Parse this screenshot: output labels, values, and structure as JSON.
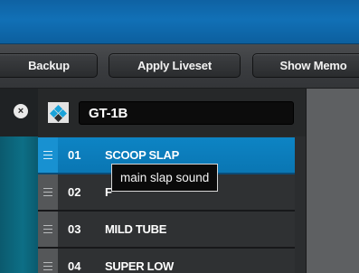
{
  "toolbar": {
    "backup_label": "Backup",
    "apply_liveset_label": "Apply Liveset",
    "show_memo_label": "Show Memo"
  },
  "panel": {
    "liveset_name": "GT-1B",
    "close_glyph": "×"
  },
  "tones": [
    {
      "number": "01",
      "name": "SCOOP SLAP",
      "selected": true
    },
    {
      "number": "02",
      "name": "F",
      "selected": false
    },
    {
      "number": "03",
      "name": "MILD TUBE",
      "selected": false
    },
    {
      "number": "04",
      "name": "SUPER LOW",
      "selected": false
    }
  ],
  "tooltip": {
    "text": "main slap sound"
  },
  "colors": {
    "titlebar_blue": "#1170b6",
    "selected_row": "#0d84c4",
    "teal_strip": "#0d6f86"
  },
  "icons": {
    "row_handle": "drag-handle-icon",
    "tone_icon": "tone-diamond-icon",
    "close": "close-icon"
  }
}
